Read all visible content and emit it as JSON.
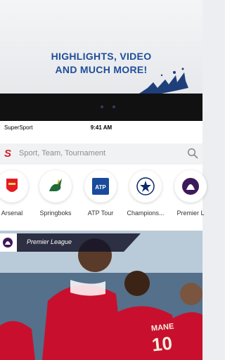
{
  "promo": {
    "headline_line1": "HIGHLIGHTS, VIDEO",
    "headline_line2": "AND MUCH MORE!",
    "accent_color": "#1f4d9a"
  },
  "status_bar": {
    "carrier": "SuperSport",
    "time": "9:41 AM"
  },
  "search": {
    "logo": "S",
    "placeholder": "Sport, Team, Tournament",
    "icon": "search-icon"
  },
  "favorites": [
    {
      "label": "Arsenal",
      "icon": "arsenal-crest-icon"
    },
    {
      "label": "Springboks",
      "icon": "springbok-icon"
    },
    {
      "label": "ATP Tour",
      "icon": "atp-logo-icon"
    },
    {
      "label": "Champions...",
      "icon": "champions-league-icon"
    },
    {
      "label": "Premier L",
      "icon": "premier-league-icon"
    }
  ],
  "hero": {
    "tag": "Premier League",
    "shirt_name_1": "MANE",
    "shirt_number_1": "10"
  },
  "colors": {
    "brand_red": "#d41f26",
    "background": "#ffffff"
  }
}
